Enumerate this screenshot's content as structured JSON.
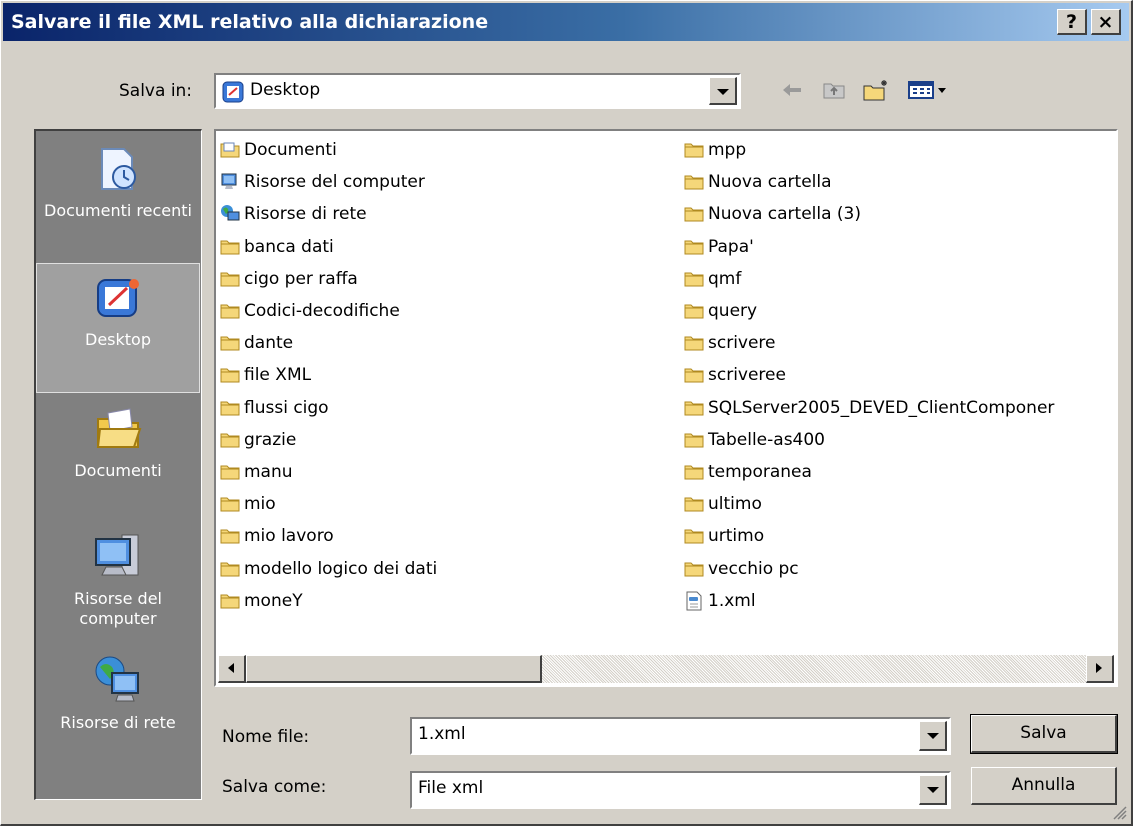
{
  "window": {
    "title": "Salvare il file XML relativo alla dichiarazione",
    "help_label": "?",
    "close_label": "×"
  },
  "save_in": {
    "label": "Salva in:",
    "value": "Desktop",
    "value_icon": "desktop-icon"
  },
  "toolbar": {
    "back_icon": "back-arrow-icon",
    "up_icon": "up-folder-icon",
    "new_folder_icon": "new-folder-icon",
    "view_menu_icon": "view-menu-icon"
  },
  "places": [
    {
      "label": "Documenti recenti",
      "icon": "recent-documents-icon",
      "selected": false
    },
    {
      "label": "Desktop",
      "icon": "desktop-icon",
      "selected": true
    },
    {
      "label": "Documenti",
      "icon": "documents-icon",
      "selected": false
    },
    {
      "label": "Risorse del computer",
      "icon": "my-computer-icon",
      "selected": false
    },
    {
      "label": "Risorse di rete",
      "icon": "network-icon",
      "selected": false
    }
  ],
  "files_col1": [
    {
      "name": "Documenti",
      "icon": "documents-folder-icon"
    },
    {
      "name": "Risorse del computer",
      "icon": "my-computer-icon"
    },
    {
      "name": "Risorse di rete",
      "icon": "network-icon"
    },
    {
      "name": "banca dati",
      "icon": "folder-icon"
    },
    {
      "name": "cigo per raffa",
      "icon": "folder-icon"
    },
    {
      "name": "Codici-decodifiche",
      "icon": "folder-icon"
    },
    {
      "name": "dante",
      "icon": "folder-icon"
    },
    {
      "name": "file XML",
      "icon": "folder-icon"
    },
    {
      "name": "flussi cigo",
      "icon": "folder-icon"
    },
    {
      "name": "grazie",
      "icon": "folder-icon"
    },
    {
      "name": "manu",
      "icon": "folder-icon"
    },
    {
      "name": "mio",
      "icon": "folder-icon"
    },
    {
      "name": "mio lavoro",
      "icon": "folder-icon"
    },
    {
      "name": "modello logico dei dati",
      "icon": "folder-icon"
    },
    {
      "name": "moneY",
      "icon": "folder-icon"
    }
  ],
  "files_col2": [
    {
      "name": "mpp",
      "icon": "folder-icon"
    },
    {
      "name": "Nuova cartella",
      "icon": "folder-icon"
    },
    {
      "name": "Nuova cartella (3)",
      "icon": "folder-icon"
    },
    {
      "name": "Papa'",
      "icon": "folder-icon"
    },
    {
      "name": "qmf",
      "icon": "folder-icon"
    },
    {
      "name": "query",
      "icon": "folder-icon"
    },
    {
      "name": "scrivere",
      "icon": "folder-icon"
    },
    {
      "name": "scriveree",
      "icon": "folder-icon"
    },
    {
      "name": "SQLServer2005_DEVED_ClientComponer",
      "icon": "folder-icon"
    },
    {
      "name": "Tabelle-as400",
      "icon": "folder-icon"
    },
    {
      "name": "temporanea",
      "icon": "folder-icon"
    },
    {
      "name": "ultimo",
      "icon": "folder-icon"
    },
    {
      "name": "urtimo",
      "icon": "folder-icon"
    },
    {
      "name": "vecchio pc",
      "icon": "folder-icon"
    },
    {
      "name": "1.xml",
      "icon": "xml-file-icon"
    }
  ],
  "filename": {
    "label": "Nome file:",
    "value": "1.xml"
  },
  "filetype": {
    "label": "Salva come:",
    "value": "File xml"
  },
  "buttons": {
    "save": "Salva",
    "cancel": "Annulla"
  },
  "scroll": {
    "horizontal_position": 0.0
  },
  "colors": {
    "title_start": "#0a246a",
    "title_end": "#a6caf0",
    "face": "#d4d0c8",
    "places_bg": "#808080",
    "folder": "#f5d77a"
  }
}
